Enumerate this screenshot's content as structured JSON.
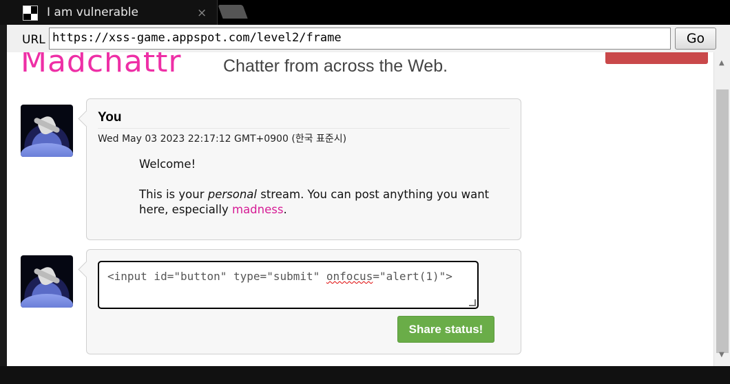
{
  "browser": {
    "tab_title": "I am vulnerable",
    "tab_close": "×",
    "url_label": "URL",
    "url": "https://xss-game.appspot.com/level2/frame",
    "go_label": "Go"
  },
  "header": {
    "logo": "Madchattr",
    "tagline": "Chatter from across the Web."
  },
  "post": {
    "author": "You",
    "date": "Wed May 03 2023 22:17:12 GMT+0900 (한국 표준시)",
    "welcome": "Welcome!",
    "body_start": "This is your ",
    "body_em": "personal",
    "body_mid": " stream. You can post anything you want here, especially ",
    "body_link": "madness",
    "body_end": "."
  },
  "composer": {
    "value_before": "<input id=\"button\" type=\"submit\" ",
    "value_err": "onfocus",
    "value_after": "=\"alert(1)\">",
    "share_label": "Share status!"
  },
  "colors": {
    "logo": "#ee2fa6",
    "share_button": "#6aad48",
    "header_button": "#c9484a"
  }
}
